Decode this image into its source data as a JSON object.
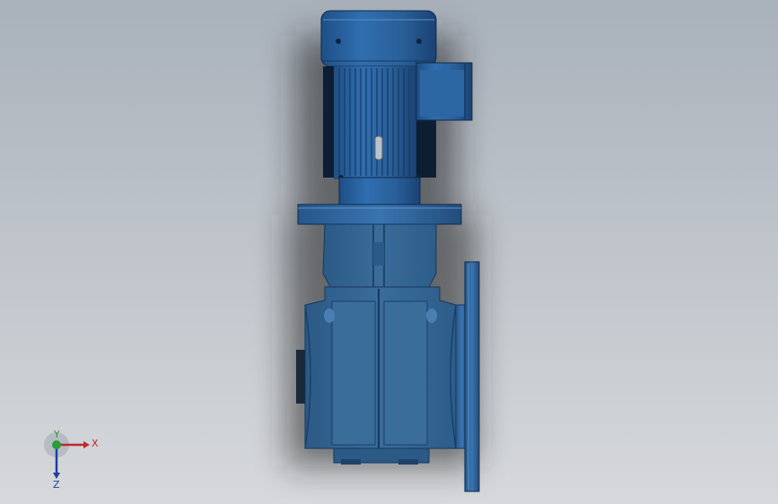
{
  "viewport": {
    "background_top": "#a9b1bb",
    "background_bottom": "#d6d8db"
  },
  "model": {
    "part_color": "#2f6496",
    "highlight_color": "#4a86c0",
    "shadow_color": "#1d4268"
  },
  "triad": {
    "x_label": "X",
    "y_label": "Y",
    "z_label": "Z",
    "x_color": "#c0282d",
    "y_color": "#2a9d36",
    "z_color": "#1f3f9c"
  }
}
